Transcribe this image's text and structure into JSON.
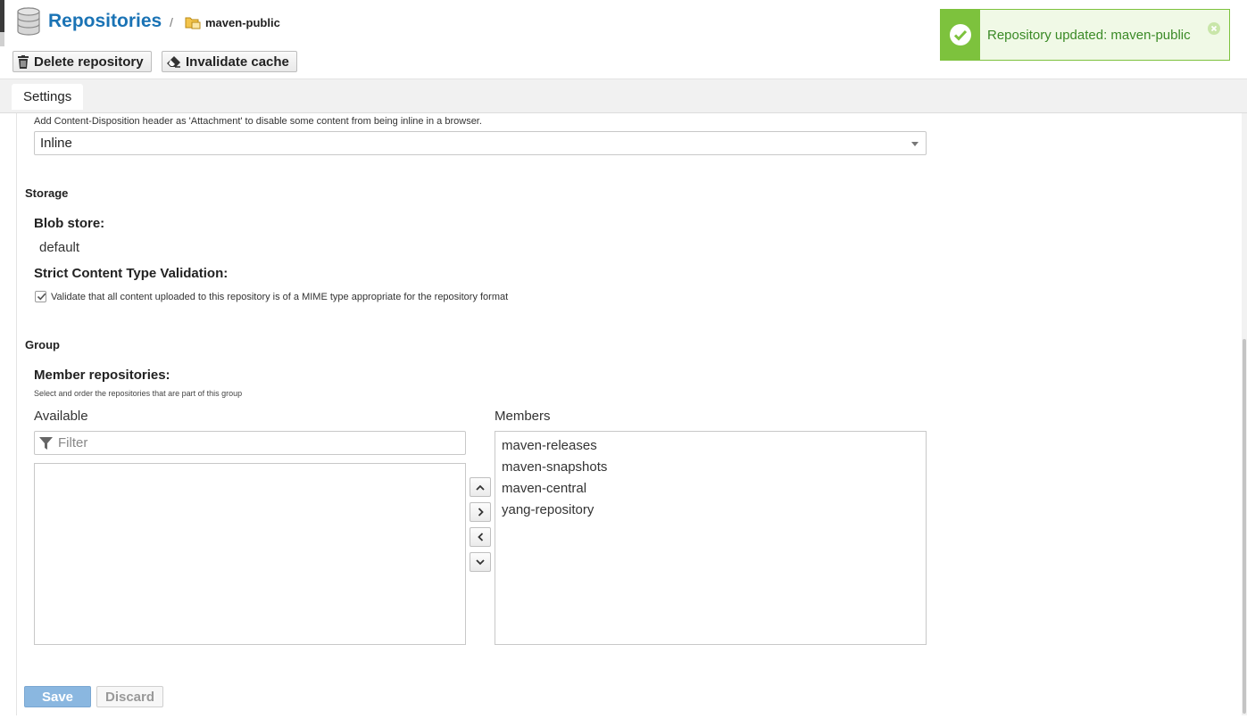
{
  "header": {
    "title": "Repositories",
    "separator": "/",
    "breadcrumb": "maven-public",
    "delete_label": "Delete repository",
    "invalidate_label": "Invalidate cache"
  },
  "toast": {
    "message": "Repository updated: maven-public",
    "color": "#7dc23d"
  },
  "tabs": [
    {
      "label": "Settings"
    }
  ],
  "content_disposition": {
    "hint": "Add Content-Disposition header as 'Attachment' to disable some content from being inline in a browser.",
    "selected": "Inline"
  },
  "storage": {
    "section": "Storage",
    "blob_label": "Blob store:",
    "blob_value": "default",
    "strict_label": "Strict Content Type Validation:",
    "strict_hint": "Validate that all content uploaded to this repository is of a MIME type appropriate for the repository format",
    "strict_checked": true
  },
  "group": {
    "section": "Group",
    "members_label": "Member repositories:",
    "members_hint": "Select and order the repositories that are part of this group",
    "available_label": "Available",
    "members_list_label": "Members",
    "filter_placeholder": "Filter",
    "available": [],
    "members": [
      "maven-releases",
      "maven-snapshots",
      "maven-central",
      "yang-repository"
    ]
  },
  "footer": {
    "save_label": "Save",
    "discard_label": "Discard"
  },
  "colors": {
    "link": "#1a73b5",
    "success": "#7dc23d",
    "save": "#8ab7e0"
  }
}
